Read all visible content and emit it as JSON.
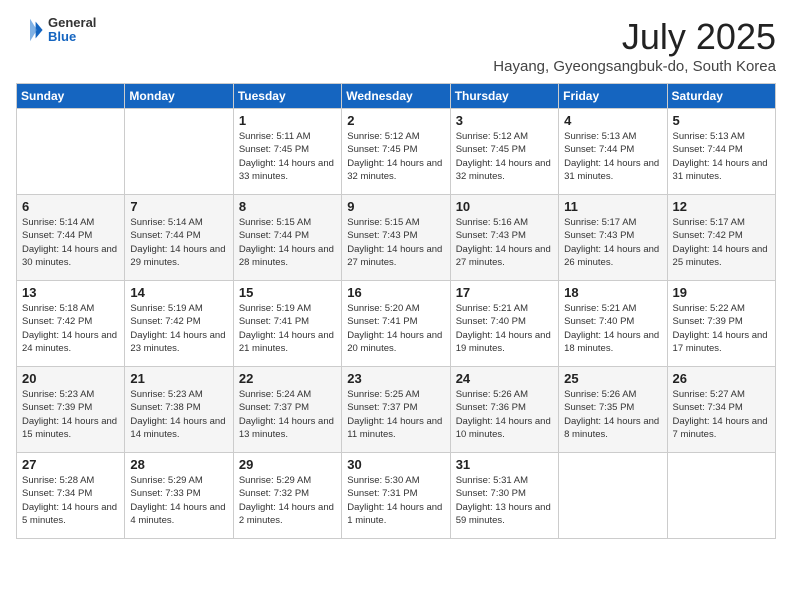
{
  "header": {
    "logo_general": "General",
    "logo_blue": "Blue",
    "month": "July 2025",
    "location": "Hayang, Gyeongsangbuk-do, South Korea"
  },
  "weekdays": [
    "Sunday",
    "Monday",
    "Tuesday",
    "Wednesday",
    "Thursday",
    "Friday",
    "Saturday"
  ],
  "weeks": [
    [
      {
        "day": "",
        "info": ""
      },
      {
        "day": "",
        "info": ""
      },
      {
        "day": "1",
        "sunrise": "Sunrise: 5:11 AM",
        "sunset": "Sunset: 7:45 PM",
        "daylight": "Daylight: 14 hours and 33 minutes."
      },
      {
        "day": "2",
        "sunrise": "Sunrise: 5:12 AM",
        "sunset": "Sunset: 7:45 PM",
        "daylight": "Daylight: 14 hours and 32 minutes."
      },
      {
        "day": "3",
        "sunrise": "Sunrise: 5:12 AM",
        "sunset": "Sunset: 7:45 PM",
        "daylight": "Daylight: 14 hours and 32 minutes."
      },
      {
        "day": "4",
        "sunrise": "Sunrise: 5:13 AM",
        "sunset": "Sunset: 7:44 PM",
        "daylight": "Daylight: 14 hours and 31 minutes."
      },
      {
        "day": "5",
        "sunrise": "Sunrise: 5:13 AM",
        "sunset": "Sunset: 7:44 PM",
        "daylight": "Daylight: 14 hours and 31 minutes."
      }
    ],
    [
      {
        "day": "6",
        "sunrise": "Sunrise: 5:14 AM",
        "sunset": "Sunset: 7:44 PM",
        "daylight": "Daylight: 14 hours and 30 minutes."
      },
      {
        "day": "7",
        "sunrise": "Sunrise: 5:14 AM",
        "sunset": "Sunset: 7:44 PM",
        "daylight": "Daylight: 14 hours and 29 minutes."
      },
      {
        "day": "8",
        "sunrise": "Sunrise: 5:15 AM",
        "sunset": "Sunset: 7:44 PM",
        "daylight": "Daylight: 14 hours and 28 minutes."
      },
      {
        "day": "9",
        "sunrise": "Sunrise: 5:15 AM",
        "sunset": "Sunset: 7:43 PM",
        "daylight": "Daylight: 14 hours and 27 minutes."
      },
      {
        "day": "10",
        "sunrise": "Sunrise: 5:16 AM",
        "sunset": "Sunset: 7:43 PM",
        "daylight": "Daylight: 14 hours and 27 minutes."
      },
      {
        "day": "11",
        "sunrise": "Sunrise: 5:17 AM",
        "sunset": "Sunset: 7:43 PM",
        "daylight": "Daylight: 14 hours and 26 minutes."
      },
      {
        "day": "12",
        "sunrise": "Sunrise: 5:17 AM",
        "sunset": "Sunset: 7:42 PM",
        "daylight": "Daylight: 14 hours and 25 minutes."
      }
    ],
    [
      {
        "day": "13",
        "sunrise": "Sunrise: 5:18 AM",
        "sunset": "Sunset: 7:42 PM",
        "daylight": "Daylight: 14 hours and 24 minutes."
      },
      {
        "day": "14",
        "sunrise": "Sunrise: 5:19 AM",
        "sunset": "Sunset: 7:42 PM",
        "daylight": "Daylight: 14 hours and 23 minutes."
      },
      {
        "day": "15",
        "sunrise": "Sunrise: 5:19 AM",
        "sunset": "Sunset: 7:41 PM",
        "daylight": "Daylight: 14 hours and 21 minutes."
      },
      {
        "day": "16",
        "sunrise": "Sunrise: 5:20 AM",
        "sunset": "Sunset: 7:41 PM",
        "daylight": "Daylight: 14 hours and 20 minutes."
      },
      {
        "day": "17",
        "sunrise": "Sunrise: 5:21 AM",
        "sunset": "Sunset: 7:40 PM",
        "daylight": "Daylight: 14 hours and 19 minutes."
      },
      {
        "day": "18",
        "sunrise": "Sunrise: 5:21 AM",
        "sunset": "Sunset: 7:40 PM",
        "daylight": "Daylight: 14 hours and 18 minutes."
      },
      {
        "day": "19",
        "sunrise": "Sunrise: 5:22 AM",
        "sunset": "Sunset: 7:39 PM",
        "daylight": "Daylight: 14 hours and 17 minutes."
      }
    ],
    [
      {
        "day": "20",
        "sunrise": "Sunrise: 5:23 AM",
        "sunset": "Sunset: 7:39 PM",
        "daylight": "Daylight: 14 hours and 15 minutes."
      },
      {
        "day": "21",
        "sunrise": "Sunrise: 5:23 AM",
        "sunset": "Sunset: 7:38 PM",
        "daylight": "Daylight: 14 hours and 14 minutes."
      },
      {
        "day": "22",
        "sunrise": "Sunrise: 5:24 AM",
        "sunset": "Sunset: 7:37 PM",
        "daylight": "Daylight: 14 hours and 13 minutes."
      },
      {
        "day": "23",
        "sunrise": "Sunrise: 5:25 AM",
        "sunset": "Sunset: 7:37 PM",
        "daylight": "Daylight: 14 hours and 11 minutes."
      },
      {
        "day": "24",
        "sunrise": "Sunrise: 5:26 AM",
        "sunset": "Sunset: 7:36 PM",
        "daylight": "Daylight: 14 hours and 10 minutes."
      },
      {
        "day": "25",
        "sunrise": "Sunrise: 5:26 AM",
        "sunset": "Sunset: 7:35 PM",
        "daylight": "Daylight: 14 hours and 8 minutes."
      },
      {
        "day": "26",
        "sunrise": "Sunrise: 5:27 AM",
        "sunset": "Sunset: 7:34 PM",
        "daylight": "Daylight: 14 hours and 7 minutes."
      }
    ],
    [
      {
        "day": "27",
        "sunrise": "Sunrise: 5:28 AM",
        "sunset": "Sunset: 7:34 PM",
        "daylight": "Daylight: 14 hours and 5 minutes."
      },
      {
        "day": "28",
        "sunrise": "Sunrise: 5:29 AM",
        "sunset": "Sunset: 7:33 PM",
        "daylight": "Daylight: 14 hours and 4 minutes."
      },
      {
        "day": "29",
        "sunrise": "Sunrise: 5:29 AM",
        "sunset": "Sunset: 7:32 PM",
        "daylight": "Daylight: 14 hours and 2 minutes."
      },
      {
        "day": "30",
        "sunrise": "Sunrise: 5:30 AM",
        "sunset": "Sunset: 7:31 PM",
        "daylight": "Daylight: 14 hours and 1 minute."
      },
      {
        "day": "31",
        "sunrise": "Sunrise: 5:31 AM",
        "sunset": "Sunset: 7:30 PM",
        "daylight": "Daylight: 13 hours and 59 minutes."
      },
      {
        "day": "",
        "info": ""
      },
      {
        "day": "",
        "info": ""
      }
    ]
  ]
}
